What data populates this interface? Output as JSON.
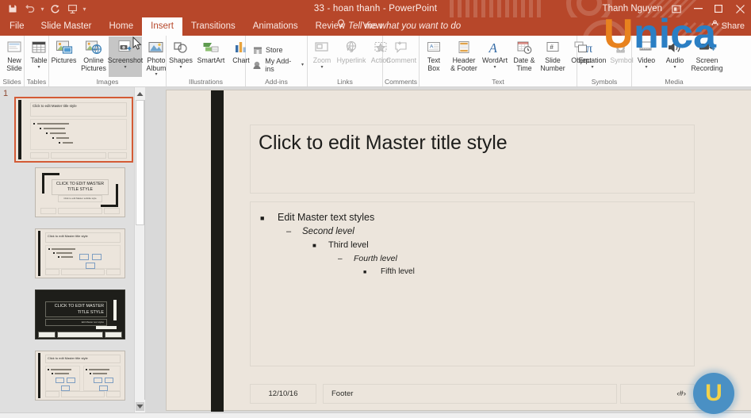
{
  "app": {
    "title": "33 - hoan thanh  -  PowerPoint",
    "account": "Thanh Nguyen",
    "accent_color": "#b7472a"
  },
  "quick_access": [
    {
      "name": "save-icon",
      "glyph": "ὋE"
    },
    {
      "name": "undo-icon",
      "glyph": "↶"
    },
    {
      "name": "redo-icon",
      "glyph": "↻"
    },
    {
      "name": "start-slideshow-icon",
      "glyph": "⎙"
    },
    {
      "name": "customize-qat-icon",
      "glyph": "▾"
    }
  ],
  "window_buttons": {
    "ribbon_display": "❐",
    "minimize": "–",
    "maximize": "□",
    "close": "✕"
  },
  "tabs": [
    {
      "label": "File",
      "active": false
    },
    {
      "label": "Slide Master",
      "active": false
    },
    {
      "label": "Home",
      "active": false
    },
    {
      "label": "Insert",
      "active": true
    },
    {
      "label": "Transitions",
      "active": false
    },
    {
      "label": "Animations",
      "active": false
    },
    {
      "label": "Review",
      "active": false
    },
    {
      "label": "View",
      "active": false
    }
  ],
  "tell_me": "Tell me what you want to do",
  "share": "Share",
  "ribbon": {
    "groups": [
      {
        "name": "Slides",
        "label": "Slides",
        "buttons": [
          {
            "label": "New",
            "label2": "Slide",
            "caret": true,
            "icon": "new-slide-icon",
            "disabled": false
          }
        ]
      },
      {
        "name": "Tables",
        "label": "Tables",
        "buttons": [
          {
            "label": "Table",
            "label2": "",
            "caret": true,
            "icon": "table-icon",
            "disabled": false
          }
        ]
      },
      {
        "name": "Images",
        "label": "Images",
        "buttons": [
          {
            "label": "Pictures",
            "label2": "",
            "caret": false,
            "icon": "pictures-icon",
            "disabled": false
          },
          {
            "label": "Online",
            "label2": "Pictures",
            "caret": false,
            "icon": "online-pictures-icon",
            "disabled": false
          },
          {
            "label": "Screenshot",
            "label2": "",
            "caret": true,
            "icon": "screenshot-icon",
            "selected": true,
            "disabled": false
          },
          {
            "label": "Photo",
            "label2": "Album",
            "caret": true,
            "icon": "photo-album-icon",
            "disabled": false
          }
        ]
      },
      {
        "name": "Illustrations",
        "label": "Illustrations",
        "buttons": [
          {
            "label": "Shapes",
            "label2": "",
            "caret": true,
            "icon": "shapes-icon",
            "disabled": false
          },
          {
            "label": "SmartArt",
            "label2": "",
            "caret": false,
            "icon": "smartart-icon",
            "disabled": false
          },
          {
            "label": "Chart",
            "label2": "",
            "caret": false,
            "icon": "chart-icon",
            "disabled": false
          }
        ]
      },
      {
        "name": "Add-ins",
        "label": "Add-ins",
        "small_buttons": [
          {
            "label": "Store",
            "icon": "store-icon",
            "caret": false
          },
          {
            "label": "My Add-ins",
            "icon": "my-addins-icon",
            "caret": true
          }
        ]
      },
      {
        "name": "Links",
        "label": "Links",
        "buttons": [
          {
            "label": "Zoom",
            "label2": "",
            "caret": true,
            "icon": "zoom-icon",
            "disabled": true
          },
          {
            "label": "Hyperlink",
            "label2": "",
            "caret": false,
            "icon": "hyperlink-icon",
            "disabled": true
          },
          {
            "label": "Action",
            "label2": "",
            "caret": false,
            "icon": "action-icon",
            "disabled": true
          }
        ]
      },
      {
        "name": "Comments",
        "label": "Comments",
        "buttons": [
          {
            "label": "Comment",
            "label2": "",
            "caret": false,
            "icon": "comment-icon",
            "disabled": true
          }
        ]
      },
      {
        "name": "Text",
        "label": "Text",
        "buttons": [
          {
            "label": "Text",
            "label2": "Box",
            "caret": false,
            "icon": "text-box-icon",
            "disabled": false
          },
          {
            "label": "Header",
            "label2": "& Footer",
            "caret": false,
            "icon": "header-footer-icon",
            "disabled": false
          },
          {
            "label": "WordArt",
            "label2": "",
            "caret": true,
            "icon": "wordart-icon",
            "disabled": false
          },
          {
            "label": "Date &",
            "label2": "Time",
            "caret": false,
            "icon": "date-time-icon",
            "disabled": false
          },
          {
            "label": "Slide",
            "label2": "Number",
            "caret": false,
            "icon": "slide-number-icon",
            "disabled": false
          },
          {
            "label": "Object",
            "label2": "",
            "caret": false,
            "icon": "object-icon",
            "disabled": false
          }
        ]
      },
      {
        "name": "Symbols",
        "label": "Symbols",
        "buttons": [
          {
            "label": "Equation",
            "label2": "",
            "caret": true,
            "icon": "equation-icon",
            "disabled": false
          },
          {
            "label": "Symbol",
            "label2": "",
            "caret": false,
            "icon": "symbol-icon",
            "disabled": true
          }
        ]
      },
      {
        "name": "Media",
        "label": "Media",
        "buttons": [
          {
            "label": "Video",
            "label2": "",
            "caret": true,
            "icon": "video-icon",
            "disabled": false
          },
          {
            "label": "Audio",
            "label2": "",
            "caret": true,
            "icon": "audio-icon",
            "disabled": false
          },
          {
            "label": "Screen",
            "label2": "Recording",
            "caret": false,
            "icon": "screen-recording-icon",
            "disabled": false
          }
        ]
      }
    ]
  },
  "thumbnails": {
    "selected_number": "1",
    "slides": [
      {
        "number": "1",
        "kind": "master-title-and-content",
        "title": "Click to edit Master title style",
        "selected": true
      },
      {
        "number": "",
        "kind": "title-slide-light",
        "title": "CLICK TO EDIT MASTER TITLE STYLE",
        "subtitle": "Click to edit Master subtitle style",
        "selected": false
      },
      {
        "number": "",
        "kind": "title-and-content",
        "title": "Click to edit Master title style",
        "selected": false
      },
      {
        "number": "",
        "kind": "section-header-dark",
        "title": "CLICK TO EDIT MASTER TITLE STYLE",
        "subtitle": "Edit Master text styles",
        "selected": false
      },
      {
        "number": "",
        "kind": "two-content",
        "title": "Click to edit Master title style",
        "selected": false
      }
    ],
    "scrollbar": {
      "up": "▲",
      "down": "▼"
    }
  },
  "slide": {
    "title_placeholder": "Click to edit Master title style",
    "body_levels": [
      {
        "bullet": "■",
        "text": "Edit Master text styles"
      },
      {
        "bullet": "–",
        "text": "Second level"
      },
      {
        "bullet": "■",
        "text": "Third level"
      },
      {
        "bullet": "–",
        "text": "Fourth level"
      },
      {
        "bullet": "■",
        "text": "Fifth level"
      }
    ],
    "date_placeholder": "12/10/16",
    "footer_placeholder": "Footer",
    "slide_number_placeholder": "‹#›"
  },
  "watermark": {
    "brand_u": "U",
    "brand_rest": "nica",
    "badge_letter": "U",
    "u_color": "#e8821e",
    "nica_color": "#2b7fc4",
    "badge_bg": "#4a90c4",
    "badge_fg": "#f2d24b"
  }
}
